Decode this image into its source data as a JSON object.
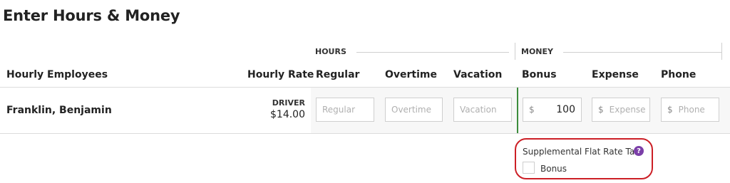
{
  "page": {
    "title": "Enter Hours & Money"
  },
  "groups": {
    "hours": "HOURS",
    "money": "MONEY"
  },
  "columns": {
    "employees": "Hourly Employees",
    "rate": "Hourly Rate",
    "regular": "Regular",
    "overtime": "Overtime",
    "vacation": "Vacation",
    "bonus": "Bonus",
    "expense": "Expense",
    "phone": "Phone"
  },
  "row": {
    "name": "Franklin, Benjamin",
    "role": "DRIVER",
    "rate": "$14.00",
    "regular_placeholder": "Regular",
    "overtime_placeholder": "Overtime",
    "vacation_placeholder": "Vacation",
    "currency": "$",
    "bonus_value": "100",
    "expense_placeholder": "Expense",
    "phone_placeholder": "Phone"
  },
  "tax": {
    "label": "Supplemental Flat Rate Tax",
    "help": "?",
    "checkbox_label": "Bonus",
    "checked": false
  },
  "colors": {
    "accent_green": "#3c8c3c",
    "highlight_red": "#cc1f26",
    "help_purple": "#7b3fa8"
  }
}
